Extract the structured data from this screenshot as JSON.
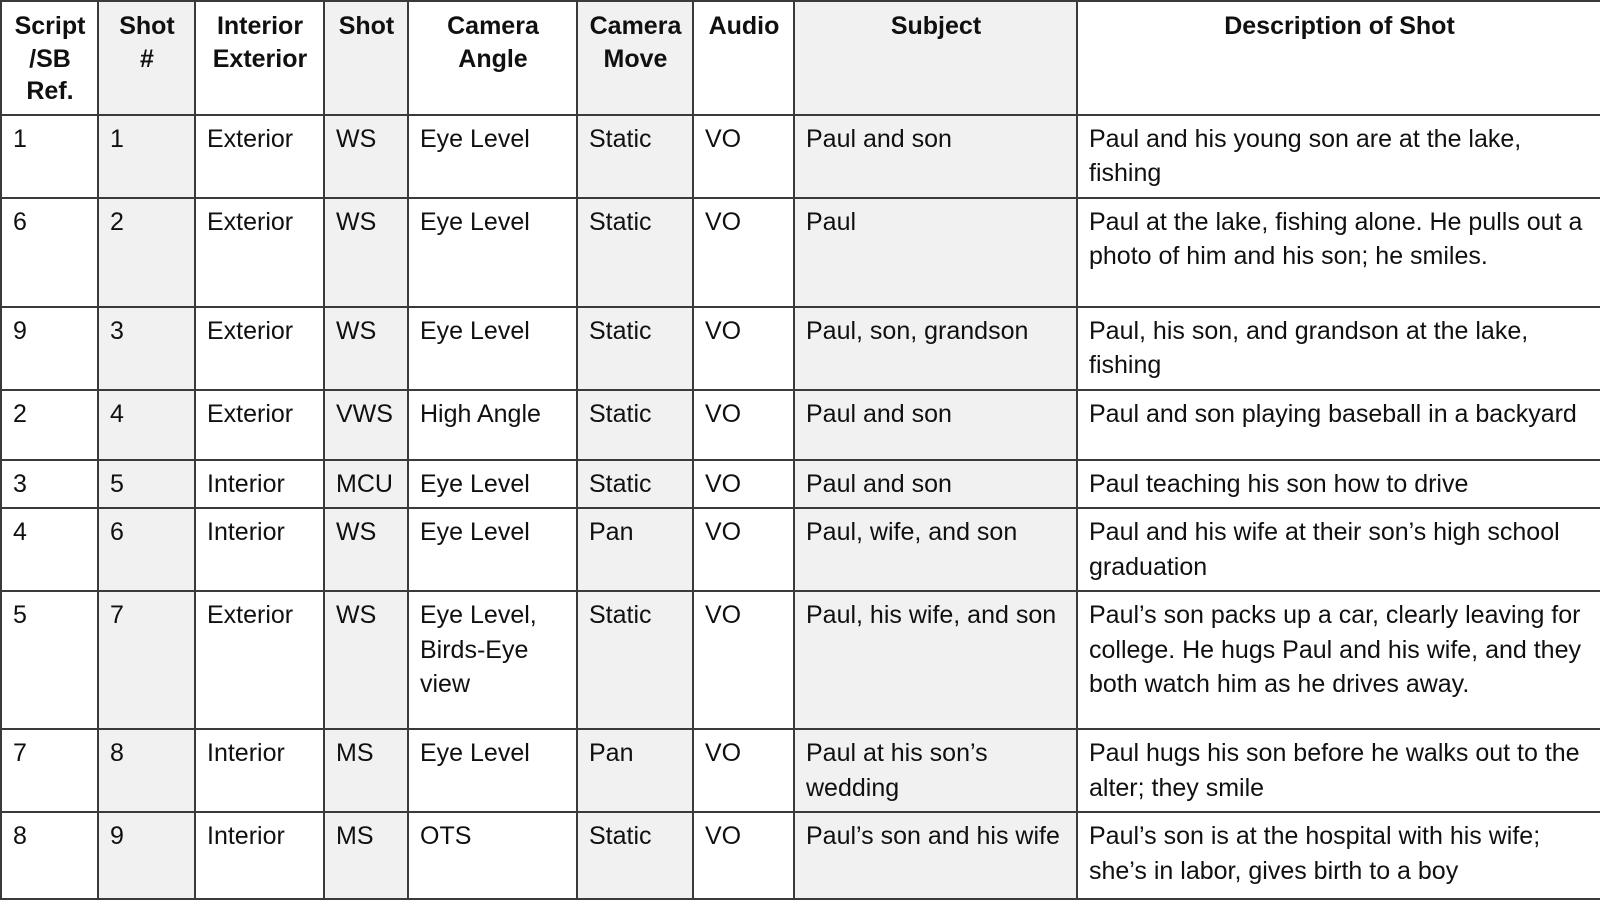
{
  "table": {
    "columns": [
      {
        "key": "script_sb_ref",
        "label": "Script /SB Ref.",
        "shaded": false
      },
      {
        "key": "shot_number",
        "label": "Shot #",
        "shaded": true
      },
      {
        "key": "interior_exterior",
        "label": "Interior Exterior",
        "shaded": false
      },
      {
        "key": "shot",
        "label": "Shot",
        "shaded": true
      },
      {
        "key": "camera_angle",
        "label": "Camera Angle",
        "shaded": false
      },
      {
        "key": "camera_move",
        "label": "Camera Move",
        "shaded": true
      },
      {
        "key": "audio",
        "label": "Audio",
        "shaded": false
      },
      {
        "key": "subject",
        "label": "Subject",
        "shaded": true
      },
      {
        "key": "description",
        "label": "Description of Shot",
        "shaded": false
      }
    ],
    "rows": [
      {
        "script_sb_ref": "1",
        "shot_number": "1",
        "interior_exterior": "Exterior",
        "shot": "WS",
        "camera_angle": "Eye Level",
        "camera_move": "Static",
        "audio": "VO",
        "subject": "Paul and son",
        "description": "Paul and his young son are at the lake, fishing"
      },
      {
        "script_sb_ref": "6",
        "shot_number": "2",
        "interior_exterior": "Exterior",
        "shot": "WS",
        "camera_angle": "Eye Level",
        "camera_move": "Static",
        "audio": "VO",
        "subject": "Paul",
        "description": "Paul at the lake, fishing alone. He pulls out a photo of him and his son; he smiles."
      },
      {
        "script_sb_ref": "9",
        "shot_number": "3",
        "interior_exterior": "Exterior",
        "shot": "WS",
        "camera_angle": "Eye Level",
        "camera_move": "Static",
        "audio": "VO",
        "subject": "Paul, son, grandson",
        "description": "Paul, his son, and grandson at the lake, fishing"
      },
      {
        "script_sb_ref": "2",
        "shot_number": "4",
        "interior_exterior": "Exterior",
        "shot": "VWS",
        "camera_angle": "High Angle",
        "camera_move": "Static",
        "audio": "VO",
        "subject": "Paul and son",
        "description": "Paul and son playing baseball in a backyard"
      },
      {
        "script_sb_ref": "3",
        "shot_number": "5",
        "interior_exterior": "Interior",
        "shot": "MCU",
        "camera_angle": "Eye Level",
        "camera_move": "Static",
        "audio": "VO",
        "subject": "Paul and son",
        "description": "Paul teaching his son how to drive"
      },
      {
        "script_sb_ref": "4",
        "shot_number": "6",
        "interior_exterior": "Interior",
        "shot": "WS",
        "camera_angle": "Eye Level",
        "camera_move": "Pan",
        "audio": "VO",
        "subject": "Paul, wife, and son",
        "description": "Paul and his wife at their son’s high school graduation"
      },
      {
        "script_sb_ref": "5",
        "shot_number": "7",
        "interior_exterior": "Exterior",
        "shot": "WS",
        "camera_angle": "Eye Level, Birds-Eye view",
        "camera_move": "Static",
        "audio": "VO",
        "subject": "Paul, his wife, and son",
        "description": "Paul’s son packs up a car, clearly leaving for college. He hugs Paul and his wife, and they both watch him as he drives away."
      },
      {
        "script_sb_ref": "7",
        "shot_number": "8",
        "interior_exterior": "Interior",
        "shot": "MS",
        "camera_angle": "Eye Level",
        "camera_move": "Pan",
        "audio": "VO",
        "subject": "Paul at his son’s wedding",
        "description": "Paul hugs his son before he walks out to the alter; they smile"
      },
      {
        "script_sb_ref": "8",
        "shot_number": "9",
        "interior_exterior": "Interior",
        "shot": "MS",
        "camera_angle": "OTS",
        "camera_move": "Static",
        "audio": "VO",
        "subject": "Paul’s son and his wife",
        "description": "Paul’s son is at the hospital with his wife; she’s in labor, gives birth to a boy"
      }
    ]
  },
  "style": {
    "border_color": "#3a3a3a",
    "shaded_column_color": "#f1f1f1",
    "text_color": "#101010",
    "background_color": "#ffffff"
  }
}
